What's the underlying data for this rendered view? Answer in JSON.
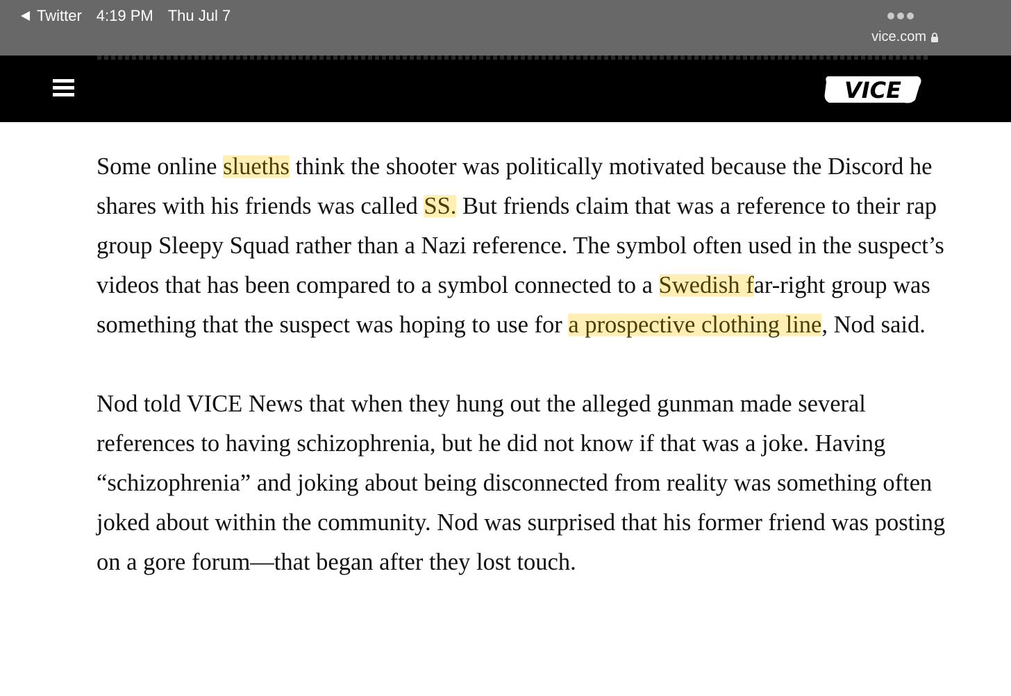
{
  "status_bar": {
    "back_app": "Twitter",
    "time": "4:19 PM",
    "date": "Thu Jul 7",
    "url": "vice.com"
  },
  "nav": {
    "logo": "VICE"
  },
  "article": {
    "p1": {
      "t1": "Some online ",
      "h1": "slueths",
      "t2": " think the shooter was politically motivated because the Discord he shares with his friends was called ",
      "h2": "SS.",
      "t3": " But friends claim that was a reference to their rap group Sleepy Squad rather than a Nazi reference. The symbol often used in the suspect’s videos that has been compared to a symbol connected to a ",
      "h3": "Swedish f",
      "t4": "ar-right group was something that the suspect was hoping to use for ",
      "h4": "a prospective clothing line",
      "t5": ", Nod said."
    },
    "p2": "Nod told VICE News that when they hung out the alleged gunman made several references to having schizophrenia, but he did not know if that was a joke. Having “schizophrenia” and joking about being disconnected from reality was something often joked about within the community. Nod was surprised that his former friend was posting on a gore forum—that began after they lost touch."
  },
  "colors": {
    "status_bar": "#686868",
    "nav_bar": "#000000",
    "highlight": "#ffe278",
    "text": "#111111"
  },
  "icons": [
    "back-arrow-icon",
    "more-icon",
    "lock-icon",
    "menu-icon",
    "vice-logo"
  ]
}
